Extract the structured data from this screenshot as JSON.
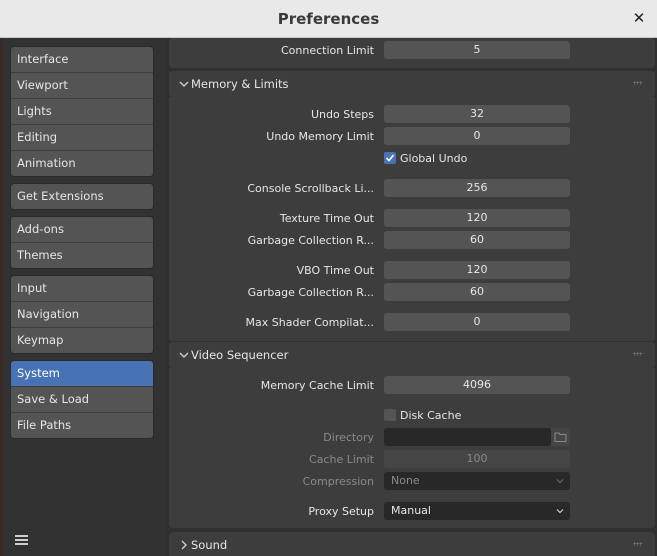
{
  "window": {
    "title": "Preferences",
    "close_glyph": "✕"
  },
  "sidebar": {
    "groups": [
      [
        "Interface",
        "Viewport",
        "Lights",
        "Editing",
        "Animation"
      ],
      [
        "Get Extensions"
      ],
      [
        "Add-ons",
        "Themes"
      ],
      [
        "Input",
        "Navigation",
        "Keymap"
      ],
      [
        "System",
        "Save & Load",
        "File Paths"
      ]
    ],
    "active": "System"
  },
  "top": {
    "connection_limit_label": "Connection Limit",
    "connection_limit_value": "5"
  },
  "memory": {
    "header": "Memory & Limits",
    "undo_steps_label": "Undo Steps",
    "undo_steps_value": "32",
    "undo_memory_label": "Undo Memory Limit",
    "undo_memory_value": "0",
    "global_undo_label": "Global Undo",
    "global_undo_checked": true,
    "console_label": "Console Scrollback Li...",
    "console_value": "256",
    "texture_timeout_label": "Texture Time Out",
    "texture_timeout_value": "120",
    "gc_rate_label_1": "Garbage Collection R...",
    "gc_rate_value_1": "60",
    "vbo_timeout_label": "VBO Time Out",
    "vbo_timeout_value": "120",
    "gc_rate_label_2": "Garbage Collection R...",
    "gc_rate_value_2": "60",
    "max_shader_label": "Max Shader Compilat...",
    "max_shader_value": "0"
  },
  "video": {
    "header": "Video Sequencer",
    "mem_cache_label": "Memory Cache Limit",
    "mem_cache_value": "4096",
    "disk_cache_label": "Disk Cache",
    "disk_cache_checked": false,
    "directory_label": "Directory",
    "directory_value": "",
    "cache_limit_label": "Cache Limit",
    "cache_limit_value": "100",
    "compression_label": "Compression",
    "compression_value": "None",
    "proxy_label": "Proxy Setup",
    "proxy_value": "Manual"
  },
  "sound": {
    "header": "Sound"
  },
  "icons": {
    "close": "close-icon",
    "hamburger": "menu-icon",
    "chevron": "chevron-icon",
    "checkmark": "checkmark-icon",
    "folder": "folder-icon",
    "grip": "drag-grip-icon"
  },
  "colors": {
    "accent": "#4772b3",
    "panel": "#3d3d3d",
    "field": "#545454",
    "titlebar": "#e9e9e9"
  }
}
